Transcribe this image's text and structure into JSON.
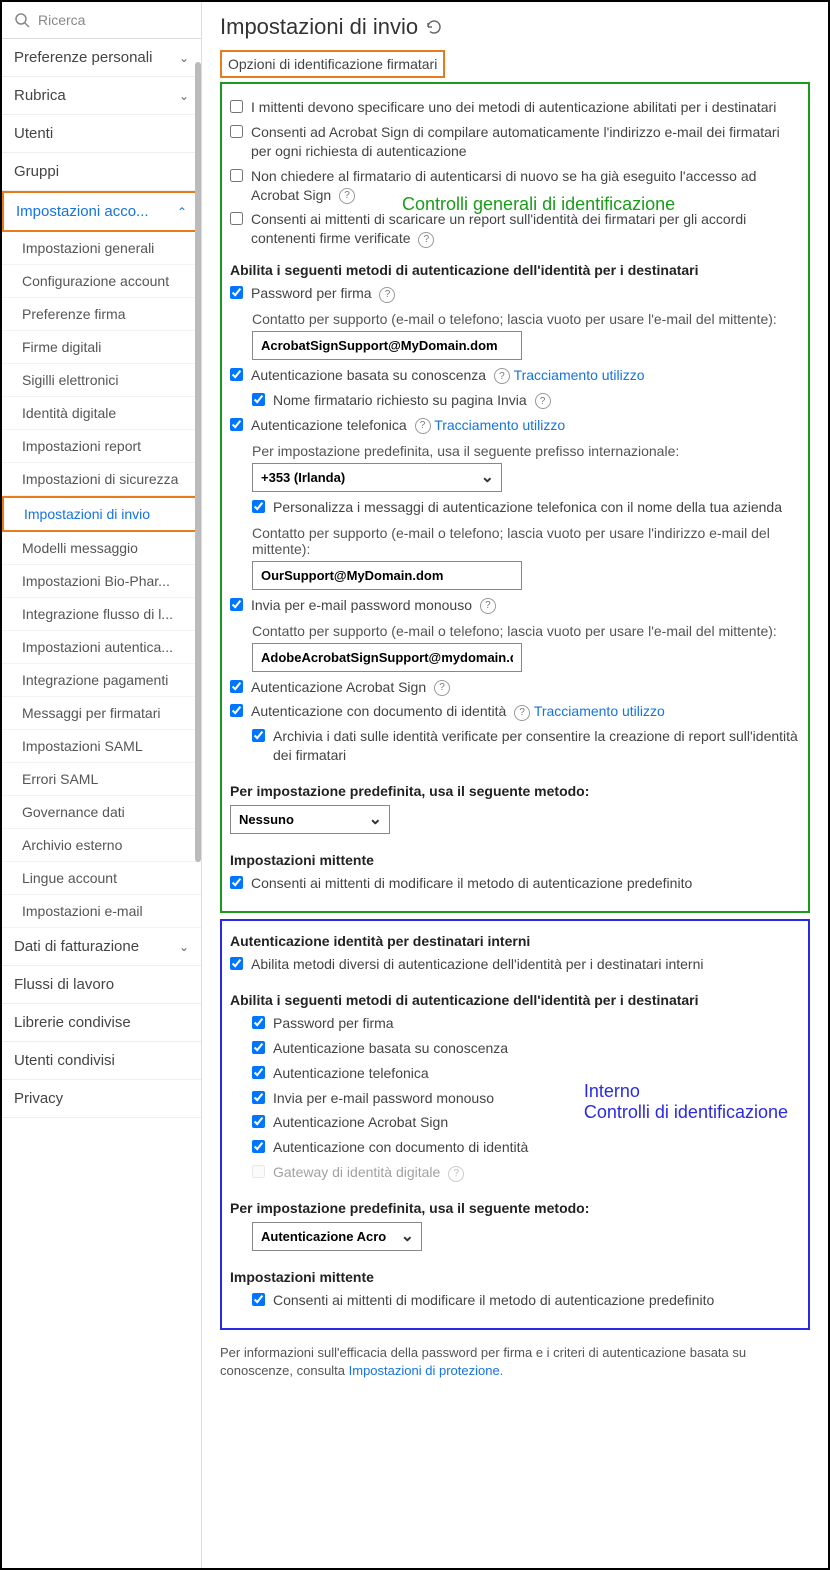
{
  "search": {
    "placeholder": "Ricerca"
  },
  "sidebar": {
    "items": [
      {
        "label": "Preferenze personali",
        "chevron": "⌄"
      },
      {
        "label": "Rubrica",
        "chevron": "⌄"
      },
      {
        "label": "Utenti"
      },
      {
        "label": "Gruppi"
      },
      {
        "label": "Impostazioni acco...",
        "chevron": "⌃",
        "highlight": true,
        "subs": [
          "Impostazioni generali",
          "Configurazione account",
          "Preferenze firma",
          "Firme digitali",
          "Sigilli elettronici",
          "Identità digitale",
          "Impostazioni report",
          "Impostazioni di sicurezza",
          "Impostazioni di invio",
          "Modelli messaggio",
          "Impostazioni Bio-Phar...",
          "Integrazione flusso di l...",
          "Impostazioni autentica...",
          "Integrazione pagamenti",
          "Messaggi per firmatari",
          "Impostazioni SAML",
          "Errori SAML",
          "Governance dati",
          "Archivio esterno",
          "Lingue account",
          "Impostazioni e-mail"
        ]
      },
      {
        "label": "Dati di fatturazione",
        "chevron": "⌄"
      },
      {
        "label": "Flussi di lavoro"
      },
      {
        "label": "Librerie condivise"
      },
      {
        "label": "Utenti condivisi"
      },
      {
        "label": "Privacy"
      }
    ]
  },
  "main": {
    "title": "Impostazioni di invio",
    "section_heading": "Opzioni di identificazione firmatari",
    "annotation_green": "Controlli generali di identificazione",
    "annotation_blue_line1": "Interno",
    "annotation_blue_line2": "Controlli di identificazione",
    "g": {
      "cb1": "I mittenti devono specificare uno dei metodi di autenticazione abilitati per i destinatari",
      "cb2": "Consenti ad Acrobat Sign di compilare automaticamente l'indirizzo e-mail dei firmatari per ogni richiesta di autenticazione",
      "cb3": "Non chiedere al firmatario di autenticarsi di nuovo se ha già eseguito l'accesso ad Acrobat Sign",
      "cb4": "Consenti ai mittenti di scaricare un report sull'identità dei firmatari per gli accordi contenenti firme verificate",
      "enable_heading": "Abilita i seguenti metodi di autenticazione dell'identità per i destinatari",
      "pwd": "Password per firma",
      "contact_email_sender": "Contatto per supporto (e-mail o telefono; lascia vuoto per usare l'e-mail del mittente):",
      "contact_addr_sender": "Contatto per supporto (e-mail o telefono; lascia vuoto per usare l'indirizzo e-mail del mittente):",
      "input1": "AcrobatSignSupport@MyDomain.dom",
      "kba": "Autenticazione basata su conoscenza",
      "tracking": "Tracciamento utilizzo",
      "kba_sub": "Nome firmatario richiesto su pagina Invia",
      "phone": "Autenticazione telefonica",
      "phone_prefix_label": "Per impostazione predefinita, usa il seguente prefisso internazionale:",
      "phone_prefix_value": "+353 (Irlanda)",
      "phone_personalize": "Personalizza i messaggi di autenticazione telefonica con il nome della tua azienda",
      "input2": "OurSupport@MyDomain.dom",
      "otp": "Invia per e-mail password monouso",
      "input3": "AdobeAcrobatSignSupport@mydomain.dom",
      "acrobat": "Autenticazione Acrobat Sign",
      "docid": "Autenticazione con documento di identità",
      "docid_sub": "Archivia i dati sulle identità verificate per consentire la creazione di report sull'identità dei firmatari",
      "default_method_label": "Per impostazione predefinita, usa il seguente metodo:",
      "default_method_value": "Nessuno",
      "sender_settings": "Impostazioni mittente",
      "sender_cb": "Consenti ai mittenti di modificare il metodo di autenticazione predefinito"
    },
    "b": {
      "heading": "Autenticazione identità per destinatari interni",
      "enable": "Abilita metodi diversi di autenticazione dell'identità per i destinatari interni",
      "sub_heading": "Abilita i seguenti metodi di autenticazione dell'identità per i destinatari",
      "m1": "Password per firma",
      "m2": "Autenticazione basata su conoscenza",
      "m3": "Autenticazione telefonica",
      "m4": "Invia per e-mail password monouso",
      "m5": "Autenticazione Acrobat Sign",
      "m6": "Autenticazione con documento di identità",
      "m7": "Gateway di identità digitale",
      "default_label": "Per impostazione predefinita, usa il seguente metodo:",
      "default_value": "Autenticazione Acro",
      "sender_settings": "Impostazioni mittente",
      "sender_cb": "Consenti ai mittenti di modificare il metodo di autenticazione predefinito"
    },
    "footer": {
      "text": "Per informazioni sull'efficacia della password per firma e i criteri di autenticazione basata su conoscenze, consulta ",
      "link": "Impostazioni di protezione."
    }
  }
}
